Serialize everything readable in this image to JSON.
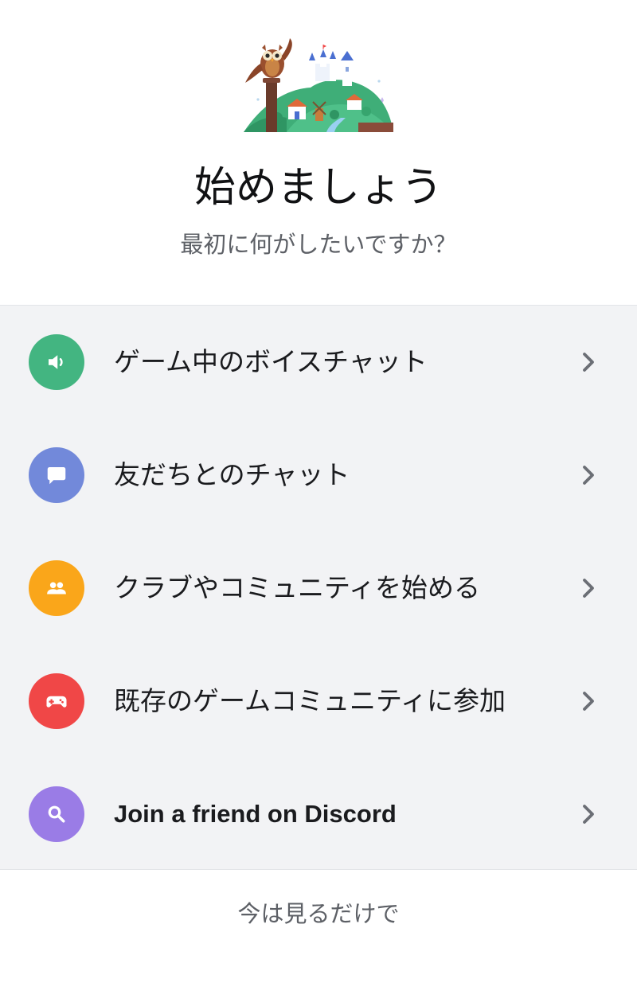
{
  "header": {
    "title": "始めましょう",
    "subtitle": "最初に何がしたいですか？"
  },
  "options": [
    {
      "label": "ゲーム中のボイスチャット",
      "icon": "speaker-icon",
      "color": "#43b581"
    },
    {
      "label": "友だちとのチャット",
      "icon": "chat-bubble-icon",
      "color": "#7289da"
    },
    {
      "label": "クラブやコミュニティを始める",
      "icon": "people-icon",
      "color": "#faa61a"
    },
    {
      "label": "既存のゲームコミュニティに参加",
      "icon": "gamepad-icon",
      "color": "#f04747"
    },
    {
      "label": "Join a friend on Discord",
      "icon": "search-icon",
      "color": "#9a7ce6"
    }
  ],
  "footer": {
    "skip_label": "今は見るだけで"
  }
}
